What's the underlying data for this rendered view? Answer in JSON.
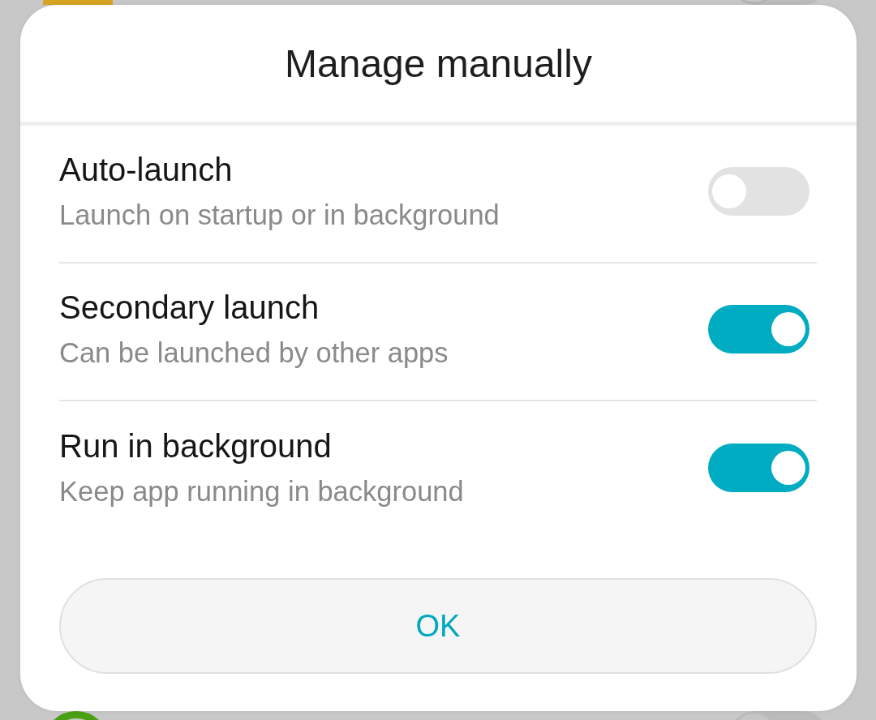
{
  "background_apps": [
    {
      "kind": "logo",
      "on": false
    },
    {
      "kind": "ring",
      "on": false
    }
  ],
  "dialog": {
    "title": "Manage manually",
    "options": [
      {
        "label": "Auto-launch",
        "description": "Launch on startup or in background",
        "on": false
      },
      {
        "label": "Secondary launch",
        "description": "Can be launched by other apps",
        "on": true
      },
      {
        "label": "Run in background",
        "description": "Keep app running in background",
        "on": true
      }
    ],
    "button": "OK"
  }
}
